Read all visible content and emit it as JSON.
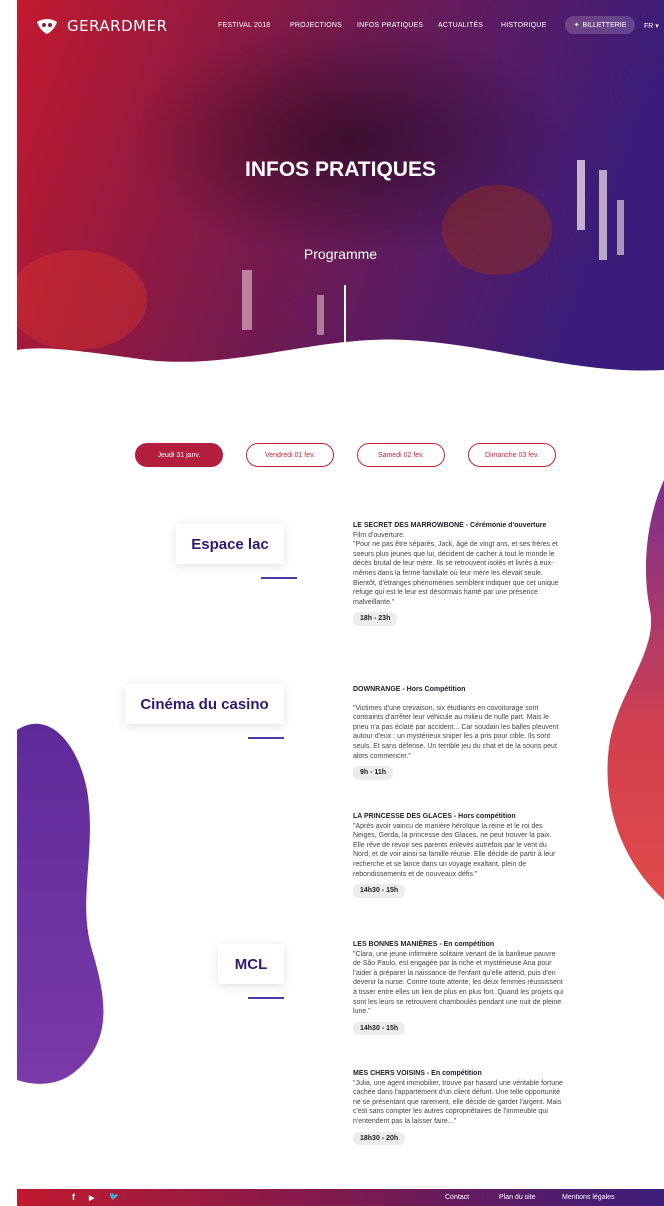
{
  "brand": {
    "name": "GERARDMER"
  },
  "nav": {
    "items": [
      "FESTIVAL 2018",
      "PROJECTIONS",
      "INFOS PRATIQUES",
      "ACTUALITÉS",
      "HISTORIQUE"
    ],
    "ticket": "BILLETTERIE",
    "lang": "FR ▾"
  },
  "hero": {
    "title": "INFOS PRATIQUES",
    "subtitle": "Programme"
  },
  "days": [
    "Jeudi 31 janv.",
    "Vendredi 01 fev.",
    "Samedi 02 fev.",
    "Dimanche 03 fev."
  ],
  "venues": [
    "Espace lac",
    "Cinéma du casino",
    "MCL"
  ],
  "events": [
    {
      "title": "LE SECRET DES MARROWBONE - Cérémonie d'ouverture",
      "sub": "Film d'ouverture.",
      "desc": "\"Pour ne pas être séparés, Jack, âgé de vingt ans, et ses frères et soeurs plus jeunes que lui, décident de cacher à tout le monde le décès brutal de leur mère. Ils se retrouvent isolés et livrés à eux-mêmes dans la ferme familiale où leur mère les élevait seule. Bientôt, d'étranges phénomènes semblent indiquer que cet unique refuge qui est le leur est désormais hanté par une présence malveillante.\"",
      "time": "18h - 23h"
    },
    {
      "title": "DOWNRANGE - Hors Compétition",
      "sub": "",
      "desc": "\"Victimes d'une crevaison, six étudiants en covoiturage sont contraints d'arrêter leur véhicule au milieu de nulle part. Mais le pneu n'a pas éclaté par accident... Car soudain les balles pleuvent autour d'eux : un mystérieux sniper les a pris pour cible. Ils sont seuls. Et sans défense. Un terrible jeu du chat et de la souris peut alors commencer.\"",
      "time": "9h - 11h"
    },
    {
      "title": "LA PRINCESSE DES GLACES - Hors compétition",
      "sub": "",
      "desc": "\"Après avoir vaincu de manière héroïque la reine et le roi des Neiges, Gerda, la princesse des Glaces, ne peut trouver la paix. Elle rêve de revoir ses parents enlevés autrefois par le vent du Nord, et de voir ainsi sa famille réunie. Elle décide de partir à leur recherche et se lance dans un voyage exaltant, plein de rebondissements et de nouveaux défis.\"",
      "time": "14h30 - 15h"
    },
    {
      "title": "LES BONNES MANIÈRES - En compétition",
      "sub": "",
      "desc": "\"Clara, une jeune infirmière solitaire venant de la banlieue pauvre de São Paulo, est engagée par la riche et mystérieuse Ana pour l'aider à préparer la naissance de l'enfant qu'elle attend, puis d'en devenir la nurse. Contre toute attente, les deux femmes réussissent à tisser entre elles un lien de plus en plus fort. Quand les projets qui sont les leurs se retrouvent chamboulés pendant une nuit de pleine lune.\"",
      "time": "14h30 - 15h"
    },
    {
      "title": "MES CHERS VOISINS - En compétition",
      "sub": "",
      "desc": "\"Julia, une agent immobilier, trouve par hasard une véritable fortune cachée dans l'appartement d'un client défunt. Une telle opportunité ne se présentant que rarement, elle décide de garder l'argent. Mais c'est sans compter les autres copropriétaires de l'immeuble qui n'entendent pas la laisser faire...\"",
      "time": "18h30 - 20h"
    }
  ],
  "footer": {
    "social": [
      "f",
      "▶",
      "🐦"
    ],
    "links": [
      "Contact",
      "Plan du site",
      "Mentions légales"
    ]
  },
  "colors": {
    "red": "#c7243a",
    "purple": "#4e2a8e",
    "navy": "#2e1a6f"
  }
}
